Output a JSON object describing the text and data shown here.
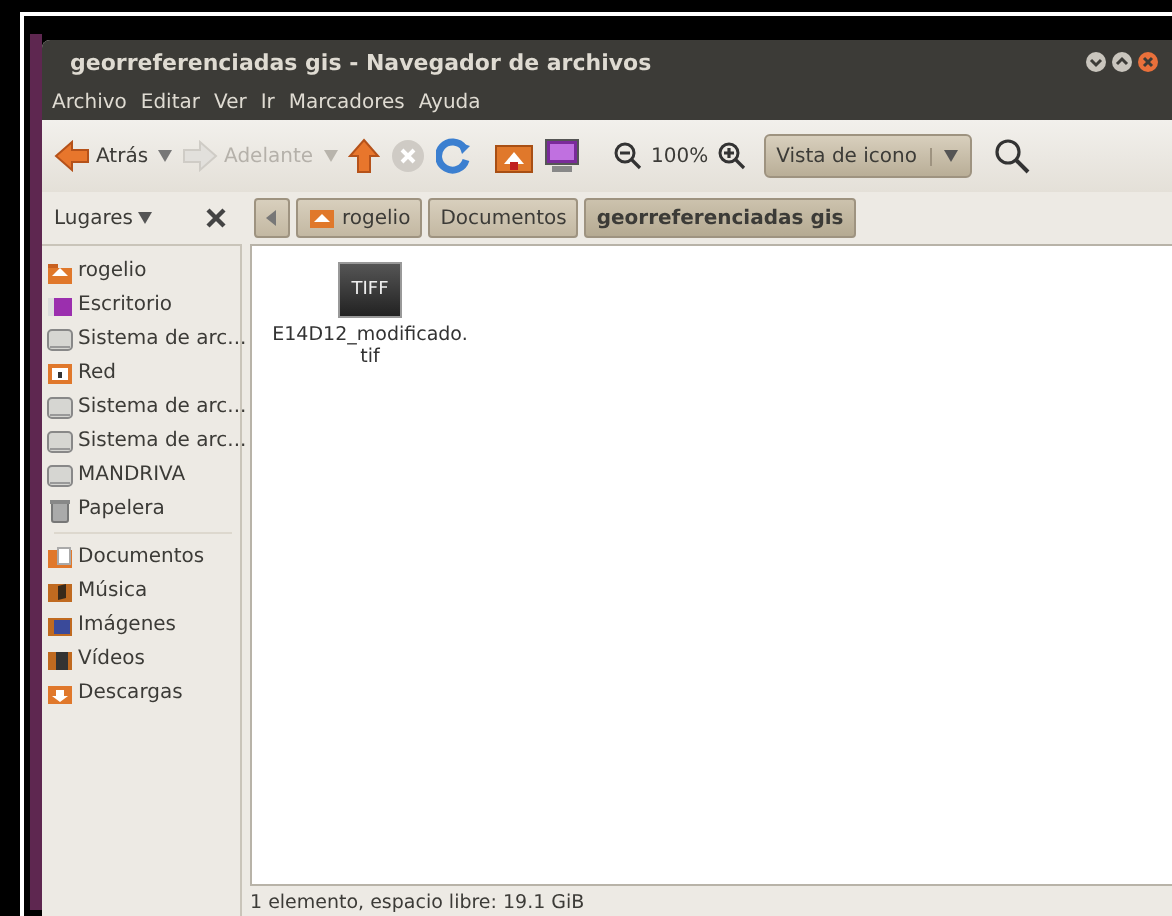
{
  "window": {
    "title": "georreferenciadas gis - Navegador de archivos"
  },
  "menu": [
    "Archivo",
    "Editar",
    "Ver",
    "Ir",
    "Marcadores",
    "Ayuda"
  ],
  "toolbar": {
    "back": {
      "label": "Atrás",
      "disabled": false
    },
    "forward": {
      "label": "Adelante",
      "disabled": true
    },
    "stop": {
      "disabled": true
    },
    "zoom": "100%",
    "view": "Vista de icono"
  },
  "sidebar": {
    "title": "Lugares",
    "groups": [
      [
        {
          "label": "rogelio",
          "kind": "home"
        },
        {
          "label": "Escritorio",
          "kind": "desktop"
        },
        {
          "label": "Sistema de arc...",
          "kind": "drive"
        },
        {
          "label": "Red",
          "kind": "network"
        },
        {
          "label": "Sistema de arc...",
          "kind": "drive"
        },
        {
          "label": "Sistema de arc...",
          "kind": "drive"
        },
        {
          "label": "MANDRIVA",
          "kind": "drive"
        },
        {
          "label": "Papelera",
          "kind": "trash"
        }
      ],
      [
        {
          "label": "Documentos",
          "kind": "documents"
        },
        {
          "label": "Música",
          "kind": "music"
        },
        {
          "label": "Imágenes",
          "kind": "pictures"
        },
        {
          "label": "Vídeos",
          "kind": "videos"
        },
        {
          "label": "Descargas",
          "kind": "downloads"
        }
      ]
    ]
  },
  "pathbar": [
    {
      "label": "rogelio",
      "kind": "home",
      "selected": false
    },
    {
      "label": "Documentos",
      "kind": "folder",
      "selected": false
    },
    {
      "label": "georreferenciadas gis",
      "kind": "folder",
      "selected": true
    }
  ],
  "files": [
    {
      "badge": "TIFF",
      "name": "E14D12_modificado.",
      "name_line_2": "tif"
    }
  ],
  "status_bar": "1 elemento, espacio libre: 19.1 GiB"
}
